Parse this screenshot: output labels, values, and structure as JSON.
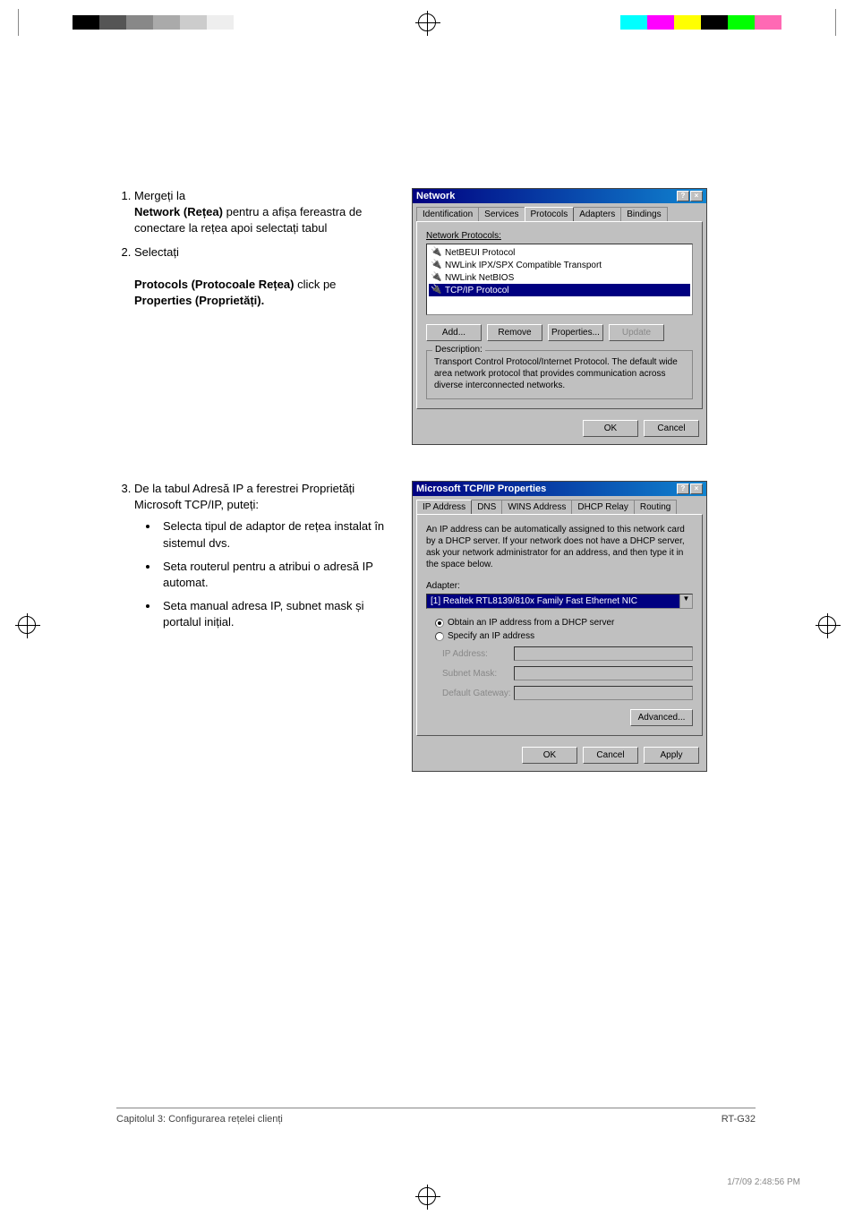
{
  "cropColorsLeft": [
    "#000",
    "#555",
    "#888",
    "#aaa",
    "#ccc",
    "#eee"
  ],
  "cropColorsRight": [
    "#00ffff",
    "#ff00ff",
    "#ffff00",
    "#000",
    "#00ff00",
    "#ff69b4"
  ],
  "step1": {
    "lead": "Mergeți la",
    "bold1": "Network (Rețea)",
    "text1": "pentru a afișa fereastra de conectare la rețea apoi selectați tabul"
  },
  "step2": {
    "lead": "Selectați",
    "bold1": "Protocols (Protocoale Rețea)",
    "text1": "click pe",
    "bold2": "Properties (Proprietăți)."
  },
  "step3": {
    "lead": "De la tabul Adresă IP a ferestrei Proprietăți Microsoft TCP/IP, puteți:",
    "bullets": [
      "Selecta tipul de adaptor de rețea instalat în sistemul dvs.",
      "Seta routerul pentru a atribui o adresă IP automat.",
      "Seta manual adresa IP, subnet mask și portalul inițial."
    ]
  },
  "dialog1": {
    "title": "Network",
    "tabs": [
      "Identification",
      "Services",
      "Protocols",
      "Adapters",
      "Bindings"
    ],
    "activeTab": "Protocols",
    "listLabel": "Network Protocols:",
    "protocols": [
      "NetBEUI Protocol",
      "NWLink IPX/SPX Compatible Transport",
      "NWLink NetBIOS",
      "TCP/IP Protocol"
    ],
    "selectedProtocol": "TCP/IP Protocol",
    "buttons": {
      "add": "Add...",
      "remove": "Remove",
      "properties": "Properties...",
      "update": "Update"
    },
    "descLabel": "Description:",
    "descText": "Transport Control Protocol/Internet Protocol. The default wide area network protocol that provides communication across diverse interconnected networks.",
    "ok": "OK",
    "cancel": "Cancel"
  },
  "dialog2": {
    "title": "Microsoft TCP/IP Properties",
    "tabs": [
      "IP Address",
      "DNS",
      "WINS Address",
      "DHCP Relay",
      "Routing"
    ],
    "activeTab": "IP Address",
    "infoText": "An IP address can be automatically assigned to this network card by a DHCP server. If your network does not have a DHCP server, ask your network administrator for an address, and then type it in the space below.",
    "adapterLabel": "Adapter:",
    "adapterValue": "[1] Realtek RTL8139/810x Family Fast Ethernet NIC",
    "radio1": "Obtain an IP address from a DHCP server",
    "radio2": "Specify an IP address",
    "fields": {
      "ip": "IP Address:",
      "subnet": "Subnet Mask:",
      "gateway": "Default Gateway:"
    },
    "advanced": "Advanced...",
    "ok": "OK",
    "cancel": "Cancel",
    "apply": "Apply"
  },
  "footer": {
    "left": "Capitolul 3: Configurarea rețelei clienți",
    "right": "RT-G32"
  },
  "pdfFooter": "1/7/09   2:48:56 PM"
}
